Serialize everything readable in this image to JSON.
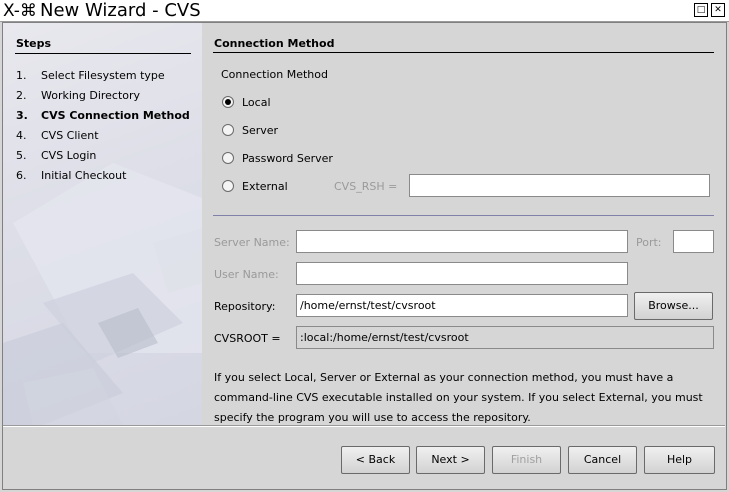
{
  "window": {
    "title": "New Wizard - CVS",
    "app_icon": "x-window-icon"
  },
  "steps": {
    "title": "Steps",
    "items": [
      {
        "num": "1.",
        "label": "Select Filesystem type"
      },
      {
        "num": "2.",
        "label": "Working Directory"
      },
      {
        "num": "3.",
        "label": "CVS Connection Method",
        "current": true
      },
      {
        "num": "4.",
        "label": "CVS Client"
      },
      {
        "num": "5.",
        "label": "CVS Login"
      },
      {
        "num": "6.",
        "label": "Initial Checkout"
      }
    ]
  },
  "panel": {
    "title": "Connection Method",
    "group_label": "Connection Method",
    "radios": [
      {
        "label": "Local",
        "selected": true
      },
      {
        "label": "Server",
        "selected": false
      },
      {
        "label": "Password Server",
        "selected": false
      },
      {
        "label": "External",
        "selected": false
      }
    ],
    "cvs_rsh_label": "CVS_RSH =",
    "cvs_rsh_value": "",
    "server_name_label": "Server Name:",
    "server_name_value": "",
    "port_label": "Port:",
    "port_value": "",
    "user_name_label": "User Name:",
    "user_name_value": "",
    "repository_label": "Repository:",
    "repository_value": "/home/ernst/test/cvsroot",
    "browse_label": "Browse...",
    "cvsroot_label": "CVSROOT =",
    "cvsroot_value": ":local:/home/ernst/test/cvsroot",
    "note": "If you select Local, Server or External as your connection method, you must have a command-line CVS executable installed on your system. If you select External, you must specify the program you will use to access the repository."
  },
  "buttons": {
    "back": "< Back",
    "next": "Next >",
    "finish": "Finish",
    "cancel": "Cancel",
    "help": "Help"
  }
}
